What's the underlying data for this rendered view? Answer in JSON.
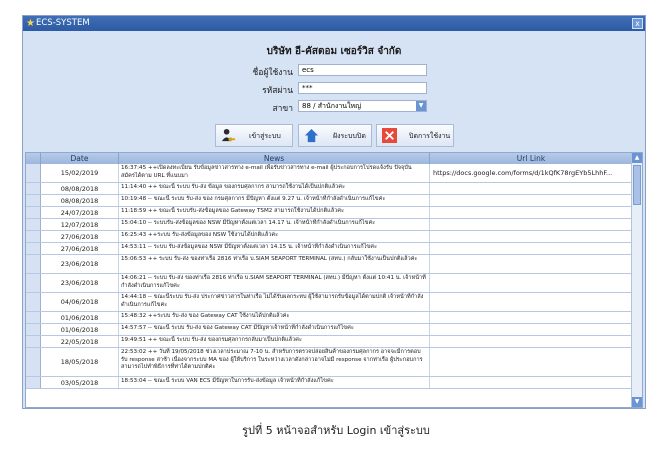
{
  "window": {
    "title": "ECS-SYSTEM",
    "close_glyph": "x"
  },
  "company": "บริษัท อี-คัสตอม เซอร์วิส จำกัด",
  "login": {
    "username_label": "ชื่อผู้ใช้งาน",
    "username_value": "ecs",
    "password_label": "รหัสผ่าน",
    "password_value": "***",
    "branch_label": "สาขา",
    "branch_value": "88 / สำนักงานใหญ่"
  },
  "buttons": {
    "login": "เข้าสู่ระบบ",
    "home": "ฝังระบบปิด",
    "close": "ปิดการใช้งาน"
  },
  "grid": {
    "columns": {
      "date": "Date",
      "news": "News",
      "url": "Url Link"
    },
    "rows": [
      {
        "date": "15/02/2019",
        "news": "16:37:45 ++เปิดลงทะเบียน รับข้อมูลข่าวสารทาง e-mail เพื่อรับข่าวสารทาง e-mail ผู้ประกอบการโปรดแจ้งรับ ปัจจุบัน สมัครได้ตาม URL ที่แนบมา",
        "url": "https://docs.google.com/forms/d/1kQfK78rgEYb5LhhF..."
      },
      {
        "date": "08/08/2018",
        "news": "11:14:40 ++ ขณะนี้ ระบบ รับ-ส่ง ข้อมูล ของกรมศุลกากร สามารถใช้งานได้เป็นปกติแล้วค่ะ",
        "url": ""
      },
      {
        "date": "08/08/2018",
        "news": "10:19:48 -- ขณะนี้ ระบบ รับ-ส่ง ของ กรมศุลกากร มีปัญหา ตั้งแต่ 9.27 น. เจ้าหน้าที่กำลังดำเนินการแก้ไขค่ะ",
        "url": ""
      },
      {
        "date": "24/07/2018",
        "news": "11:18:59 ++ ขณะนี้ ระบบรับ-ส่งข้อมูลของ Gateway TSM2 สามารถใช้งานได้ปกติแล้วค่ะ",
        "url": ""
      },
      {
        "date": "12/07/2018",
        "news": "15:04:10 -- ระบบรับ-ส่งข้อมูลของ NSW มีปัญหาตั้งแต่เวลา 14.17 น. เจ้าหน้าที่กำลังดำเนินการแก้ไขค่ะ",
        "url": ""
      },
      {
        "date": "27/06/2018",
        "news": "16:25:43 ++ระบบ รับ-ส่งข้อมูลของ NSW ใช้งานได้ปกติแล้วค่ะ",
        "url": ""
      },
      {
        "date": "27/06/2018",
        "news": "14:53:11 -- ระบบ รับ-ส่งข้อมูลของ NSW มีปัญหาตั้งแต่เวลา 14.15 น. เจ้าหน้าที่กำลังดำเนินการแก้ไขค่ะ",
        "url": ""
      },
      {
        "date": "23/06/2018",
        "news": "15:06:53 ++ ระบบ รับ-ส่ง ของท่าเรือ 2816 ท่าเรือ บ.SIAM SEAPORT TERMINAL (สทบ.) กลับมาใช้งานเป็นปกติแล้วค่ะ",
        "url": ""
      },
      {
        "date": "23/06/2018",
        "news": "14:06:21 -- ระบบ รับ-ส่ง ของท่าเรือ 2816 ท่าเรือ บ.SIAM SEAPORT TERMINAL (สทบ.) มีปัญหา ตั้งแต่ 10:41 น. เจ้าหน้าที่กำลังดำเนินการแก้ไขค่ะ",
        "url": ""
      },
      {
        "date": "04/06/2018",
        "news": "14:44:18 -- ขณะนี้ระบบ รับ-ส่ง ประกาศข่าวสารในท่าเรือ ไม่ได้รับผลกระทบ ผู้ใช้สามารถรับข้อมูลได้ตามปกติ เจ้าหน้าที่กำลังดำเนินการแก้ไขค่ะ",
        "url": ""
      },
      {
        "date": "01/06/2018",
        "news": "15:48:32 ++ระบบ รับ-ส่ง ของ Gateway CAT ใช้งานได้ปกติแล้วค่ะ",
        "url": ""
      },
      {
        "date": "01/06/2018",
        "news": "14:57:57 -- ขณะนี้ ระบบ รับ-ส่ง ของ Gateway CAT มีปัญหาเจ้าหน้าที่กำลังดำเนินการแก้ไขค่ะ",
        "url": ""
      },
      {
        "date": "22/05/2018",
        "news": "19:49:51 ++ ขณะนี้ ระบบ รับ-ส่ง ของกรมศุลกากรกลับมาเป็นปกติแล้วค่ะ",
        "url": ""
      },
      {
        "date": "18/05/2018",
        "news": "22:53:02 ++ วันที่ 19/05/2018 ช่วงเวลาประมาณ 7-10 น. สำหรับการตรวจปล่อยสินค้าของกรมศุลกากร อาจจะมีการตอบรับ response ล่าช้า เนื่องจากระบบ MA ของ ผู้ให้บริการ ในระหว่างเวลาดังกล่าวอาจไม่มี response จากท่าเรือ ผู้ประกอบการสามารถไปทำพิธีการที่ท่าได้ตามปกติค่ะ",
        "url": ""
      },
      {
        "date": "03/05/2018",
        "news": "18:53:04 -- ขณะนี้ ระบบ VAN ECS มีปัญหาในการรับ-ส่งข้อมูล เจ้าหน้าที่กำลังแก้ไขค่ะ",
        "url": ""
      }
    ]
  },
  "caption": "รูปที่ 5 หน้าจอสำหรับ Login เข้าสู่ระบบ",
  "colors": {
    "titlebar": "#2c5aa3",
    "window_bg": "#d6e3f4",
    "grid_header": "#9db6de",
    "close_btn": "#e84a3a",
    "home_btn": "#2f6fc9"
  },
  "icons": {
    "title": "star-icon",
    "login": "user-key-icon",
    "home": "home-icon",
    "close": "red-x-icon"
  }
}
